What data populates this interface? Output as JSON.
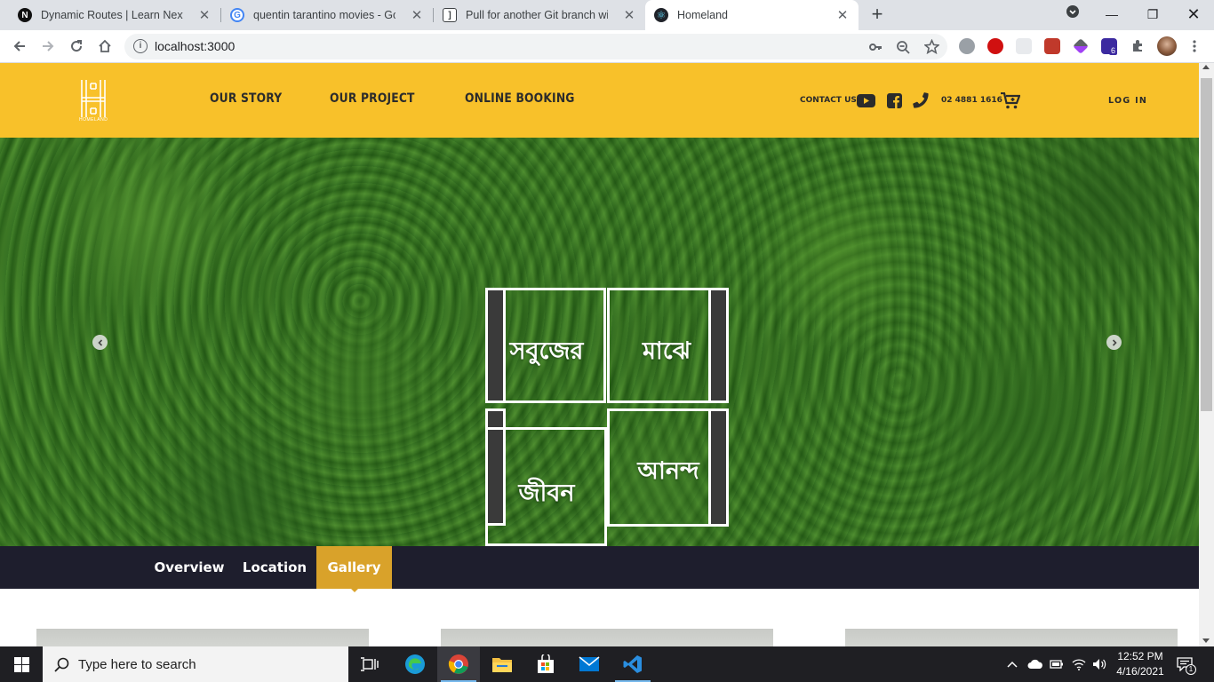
{
  "browser": {
    "tabs": [
      {
        "title": "Dynamic Routes | Learn Next.js",
        "favicon": "nextjs-icon",
        "active": false
      },
      {
        "title": "quentin tarantino movies - Goog",
        "favicon": "google-icon",
        "active": false
      },
      {
        "title": "Pull for another Git branch witho",
        "favicon": "gitkraken-icon",
        "active": false
      },
      {
        "title": "Homeland",
        "favicon": "react-icon",
        "active": true
      }
    ],
    "url": "localhost:3000",
    "extension_badge": "6"
  },
  "site": {
    "logo_caption": "HOMELAND",
    "nav": [
      "OUR STORY",
      "OUR PROJECT",
      "ONLINE BOOKING"
    ],
    "contact_label": "CONTACT US",
    "phone": "02 4881 1616",
    "login": "LOG IN",
    "brand_color": "#f8c12a"
  },
  "hero": {
    "words": [
      "সবুজের",
      "মাঝে",
      "জীবন",
      "আনন্দ"
    ]
  },
  "subnav": {
    "items": [
      "Overview",
      "Location",
      "Gallery"
    ],
    "active": "Gallery",
    "active_color": "#d9a22a"
  },
  "taskbar": {
    "search_placeholder": "Type here to search",
    "time": "12:52 PM",
    "date": "4/16/2021",
    "notification_count": "1"
  }
}
